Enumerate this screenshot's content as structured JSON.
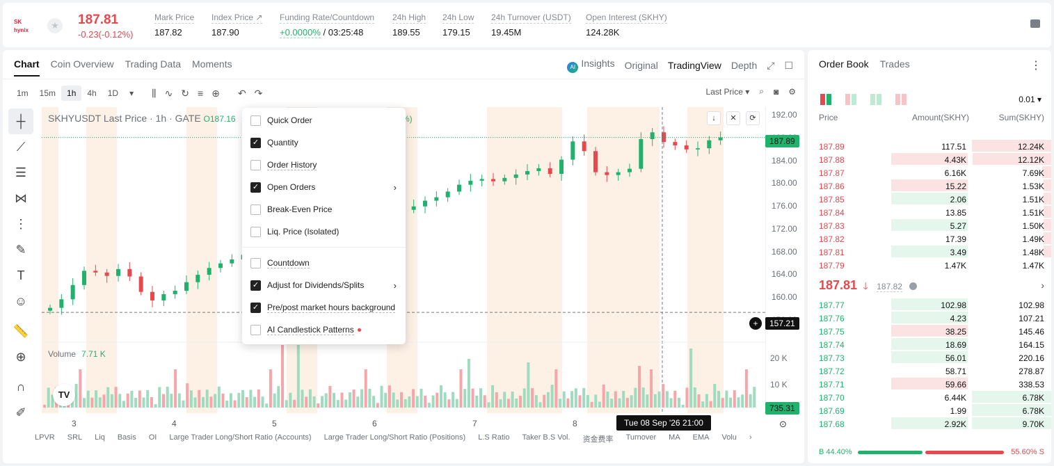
{
  "header": {
    "logo_text": "SK hynix",
    "last_price": "187.81",
    "change": "-0.23(-0.12%)",
    "stats": [
      {
        "label": "Mark Price",
        "value": "187.82"
      },
      {
        "label": "Index Price ↗",
        "value": "187.90"
      },
      {
        "label": "Funding Rate/Countdown",
        "rate": "+0.0000%",
        "countdown": "/ 03:25:48"
      },
      {
        "label": "24h High",
        "value": "189.55"
      },
      {
        "label": "24h Low",
        "value": "179.15"
      },
      {
        "label": "24h Turnover (USDT)",
        "value": "19.45M"
      },
      {
        "label": "Open Interest (SKHY)",
        "value": "124.28K"
      }
    ]
  },
  "chart": {
    "tabs": [
      "Chart",
      "Coin Overview",
      "Trading Data",
      "Moments"
    ],
    "views": [
      "Insights",
      "Original",
      "TradingView",
      "Depth"
    ],
    "timeframes": [
      "1m",
      "15m",
      "1h",
      "4h",
      "1D"
    ],
    "price_type": "Last Price ▾",
    "legend_symbol": "SKHYUSDT Last Price · 1h · GATE",
    "legend_open": "O187.16",
    "legend_pct": "%)",
    "volume_label": "Volume",
    "volume_value": "7.71 K",
    "last_tag": "187.89",
    "cross_tag": "157.21",
    "vol_tag": "735.31",
    "time_tag": "Tue 08 Sep '26   21:00",
    "vol_axis": [
      "20 K",
      "10 K"
    ],
    "x_labels": [
      "3",
      "4",
      "5",
      "6",
      "7",
      "8"
    ],
    "indicators": [
      "LPVR",
      "SRL",
      "Liq",
      "Basis",
      "OI",
      "Large Trader Long/Short Ratio (Accounts)",
      "Large Trader Long/Short Ratio (Positions)",
      "L.S Ratio",
      "Taker B.S Vol.",
      "资金费率",
      "Turnover",
      "MA",
      "EMA",
      "Volu"
    ]
  },
  "chart_data": {
    "type": "line",
    "title": "SKHYUSDT Last Price · 1h · GATE",
    "ylabel": "",
    "y_ticks": [
      "192.00",
      "188.00",
      "184.00",
      "180.00",
      "176.00",
      "172.00",
      "168.00",
      "164.00",
      "160.00",
      "156.00"
    ],
    "ylim": [
      156,
      192
    ],
    "x": [
      "3",
      "4",
      "5",
      "6",
      "7",
      "8"
    ]
  },
  "dropdown": {
    "items": [
      {
        "label": "Quick Order",
        "checked": false,
        "underline": false
      },
      {
        "label": "Quantity",
        "checked": true,
        "underline": false
      },
      {
        "label": "Order History",
        "checked": false,
        "underline": true
      },
      {
        "label": "Open Orders",
        "checked": true,
        "underline": false,
        "submenu": true
      },
      {
        "label": "Break-Even Price",
        "checked": false,
        "underline": false
      },
      {
        "label": "Liq. Price (Isolated)",
        "checked": false,
        "underline": false
      },
      {
        "label": "Countdown",
        "checked": false,
        "underline": true
      },
      {
        "label": "Adjust for Dividends/Splits",
        "checked": true,
        "underline": false,
        "submenu": true
      },
      {
        "label": "Pre/post market hours background",
        "checked": true,
        "underline": true
      },
      {
        "label": "AI Candlestick Patterns",
        "checked": false,
        "underline": true,
        "dot": true
      }
    ]
  },
  "orderbook": {
    "tabs": [
      "Order Book",
      "Trades"
    ],
    "precision": "0.01 ▾",
    "headers": [
      "Price",
      "Amount(SKHY)",
      "Sum(SKHY)"
    ],
    "asks": [
      {
        "price": "187.89",
        "amount": "117.51",
        "sum": "12.24K",
        "a": 0.0,
        "s": 1.0
      },
      {
        "price": "187.88",
        "amount": "4.43K",
        "sum": "12.12K",
        "a": 1.0,
        "s": 0.99
      },
      {
        "price": "187.87",
        "amount": "6.16K",
        "sum": "7.69K",
        "a": 0.0,
        "s": 0.11
      },
      {
        "price": "187.86",
        "amount": "15.22",
        "sum": "1.53K",
        "a": 1.0,
        "s": 0.1
      },
      {
        "price": "187.85",
        "amount": "2.06",
        "sum": "1.51K",
        "a": 1.0,
        "s": 0.1
      },
      {
        "price": "187.84",
        "amount": "13.85",
        "sum": "1.51K",
        "a": 0.0,
        "s": 0.1
      },
      {
        "price": "187.83",
        "amount": "5.27",
        "sum": "1.50K",
        "a": 1.0,
        "s": 0.1
      },
      {
        "price": "187.82",
        "amount": "17.39",
        "sum": "1.49K",
        "a": 0.0,
        "s": 0.1
      },
      {
        "price": "187.81",
        "amount": "3.49",
        "sum": "1.48K",
        "a": 1.0,
        "s": 0.1
      },
      {
        "price": "187.79",
        "amount": "1.47K",
        "sum": "1.47K",
        "a": 0.0,
        "s": 0.0
      }
    ],
    "mid_price": "187.81",
    "mid_arrow": "🡓",
    "mark_price": "187.82",
    "bids": [
      {
        "price": "187.77",
        "amount": "102.98",
        "sum": "102.98",
        "a": 1.0,
        "s": 0.0
      },
      {
        "price": "187.76",
        "amount": "4.23",
        "sum": "107.21",
        "a": 1.0,
        "s": 0.0
      },
      {
        "price": "187.75",
        "amount": "38.25",
        "sum": "145.46",
        "a": 1.0,
        "s": 0.0,
        "red": true
      },
      {
        "price": "187.74",
        "amount": "18.69",
        "sum": "164.15",
        "a": 1.0,
        "s": 0.0
      },
      {
        "price": "187.73",
        "amount": "56.01",
        "sum": "220.16",
        "a": 1.0,
        "s": 0.0
      },
      {
        "price": "187.72",
        "amount": "58.71",
        "sum": "278.87",
        "a": 0.0,
        "s": 0.0
      },
      {
        "price": "187.71",
        "amount": "59.66",
        "sum": "338.53",
        "a": 1.0,
        "s": 0.0,
        "red": true
      },
      {
        "price": "187.70",
        "amount": "6.44K",
        "sum": "6.78K",
        "a": 0.0,
        "s": 1.0
      },
      {
        "price": "187.69",
        "amount": "1.99",
        "sum": "6.78K",
        "a": 0.0,
        "s": 1.0
      },
      {
        "price": "187.68",
        "amount": "2.92K",
        "sum": "9.70K",
        "a": 1.0,
        "s": 1.0
      }
    ],
    "buy_pct": "B 44.40%",
    "sell_pct": "55.60% S",
    "buy_ratio": 0.444
  }
}
